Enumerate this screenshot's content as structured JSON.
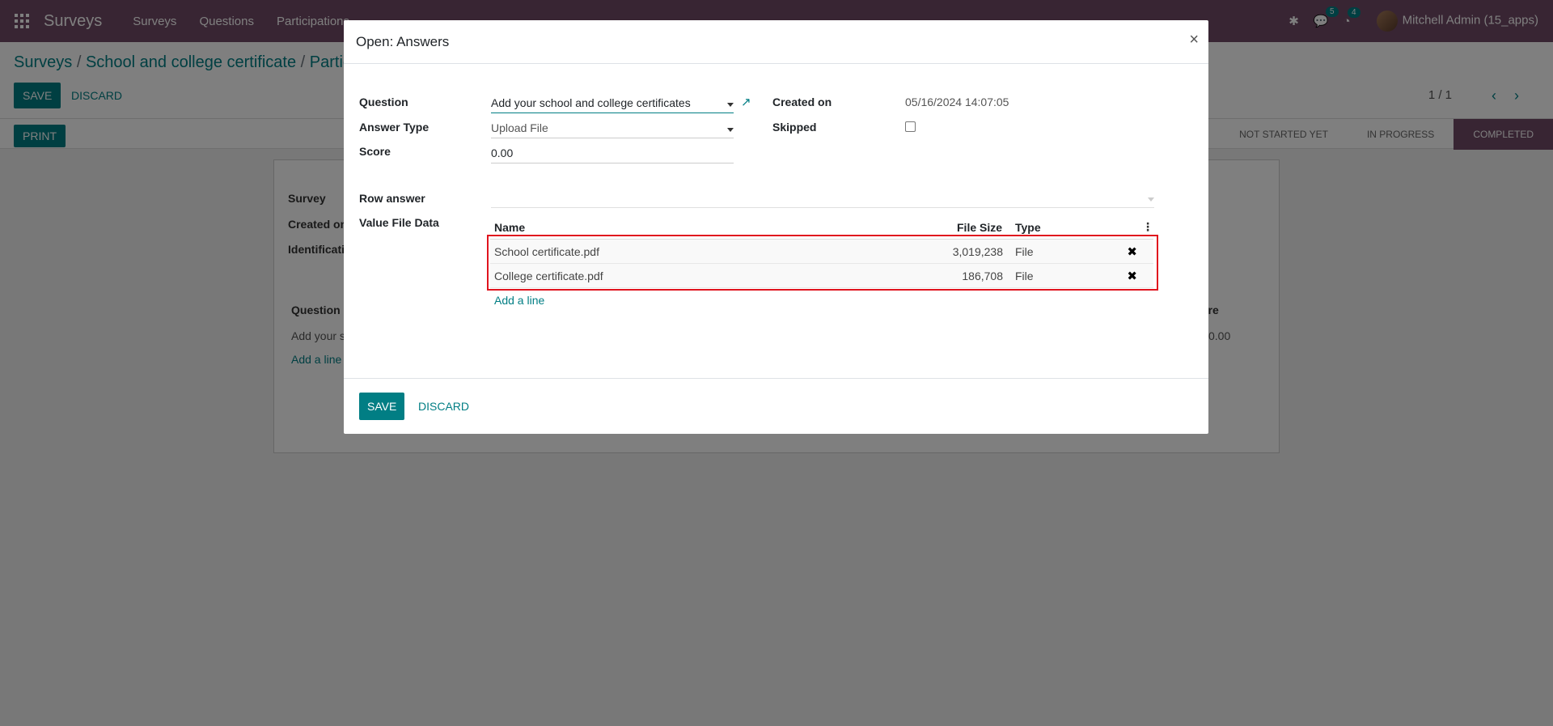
{
  "navbar": {
    "brand": "Surveys",
    "menu": [
      "Surveys",
      "Questions",
      "Participations"
    ],
    "messages_badge": "5",
    "activities_badge": "4",
    "user": "Mitchell Admin (15_apps)"
  },
  "control": {
    "breadcrumb": [
      "Surveys",
      "School and college certificate",
      "Partic"
    ],
    "save": "SAVE",
    "discard": "DISCARD",
    "print": "PRINT",
    "pager": "1 / 1",
    "stages": [
      "NOT STARTED YET",
      "IN PROGRESS",
      "COMPLETED"
    ],
    "active_stage": "COMPLETED"
  },
  "sheet": {
    "labels": [
      "Survey",
      "Created on",
      "Identificati"
    ],
    "table_header": "Question",
    "table_header_right": "ore",
    "row_text": "Add your s",
    "row_score": "0.00",
    "add_line": "Add a line"
  },
  "modal": {
    "title": "Open: Answers",
    "close": "×",
    "question_label": "Question",
    "question_value": "Add your school and college certificates",
    "answer_type_label": "Answer Type",
    "answer_type_value": "Upload File",
    "score_label": "Score",
    "score_value": "0.00",
    "created_on_label": "Created on",
    "created_on_value": "05/16/2024 14:07:05",
    "skipped_label": "Skipped",
    "row_answer_label": "Row answer",
    "value_file_label": "Value File Data",
    "table": {
      "columns": [
        "Name",
        "File Size",
        "Type"
      ],
      "rows": [
        {
          "name": "School certificate.pdf",
          "size": "3,019,238",
          "type": "File"
        },
        {
          "name": "College certificate.pdf",
          "size": "186,708",
          "type": "File"
        }
      ],
      "add_line": "Add a line"
    },
    "save": "SAVE",
    "discard": "DISCARD"
  }
}
